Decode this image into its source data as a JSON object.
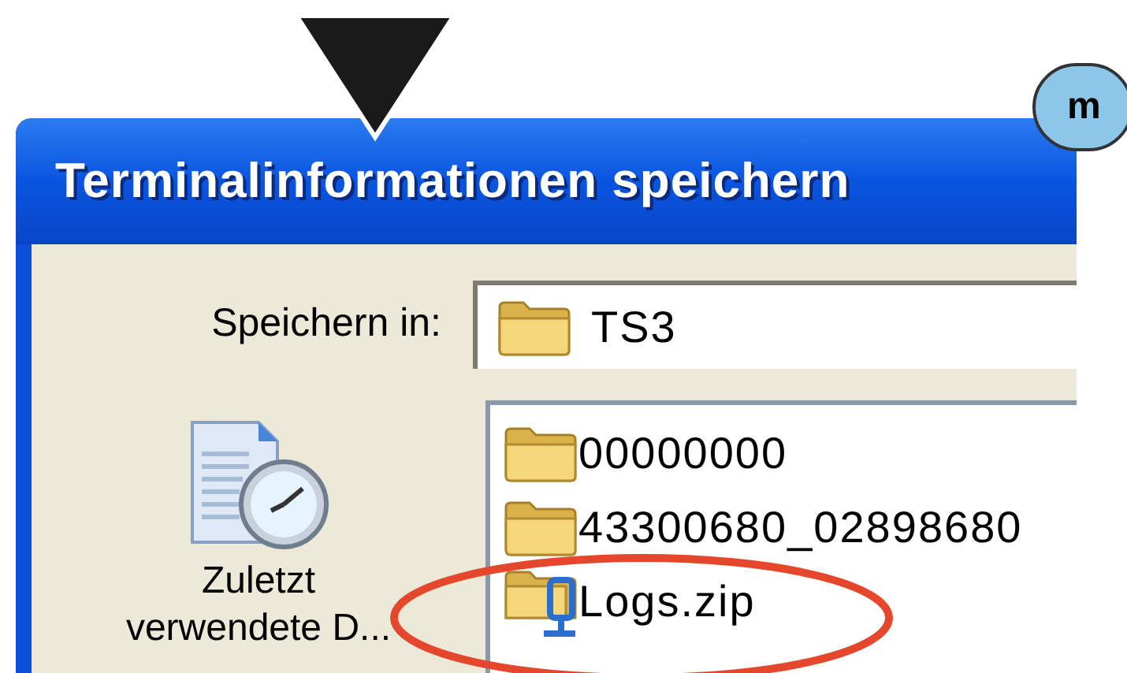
{
  "dialog": {
    "title": "Terminalinformationen speichern",
    "save_in": {
      "label": "Speichern in:",
      "value": "TS3"
    },
    "places": [
      {
        "label": "Zuletzt verwendete D..."
      }
    ],
    "files": [
      {
        "kind": "folder",
        "name": "00000000"
      },
      {
        "kind": "folder",
        "name": "43300680_02898680"
      },
      {
        "kind": "zip",
        "name": "Logs.zip"
      }
    ]
  },
  "annotation": {
    "badge": "m"
  }
}
